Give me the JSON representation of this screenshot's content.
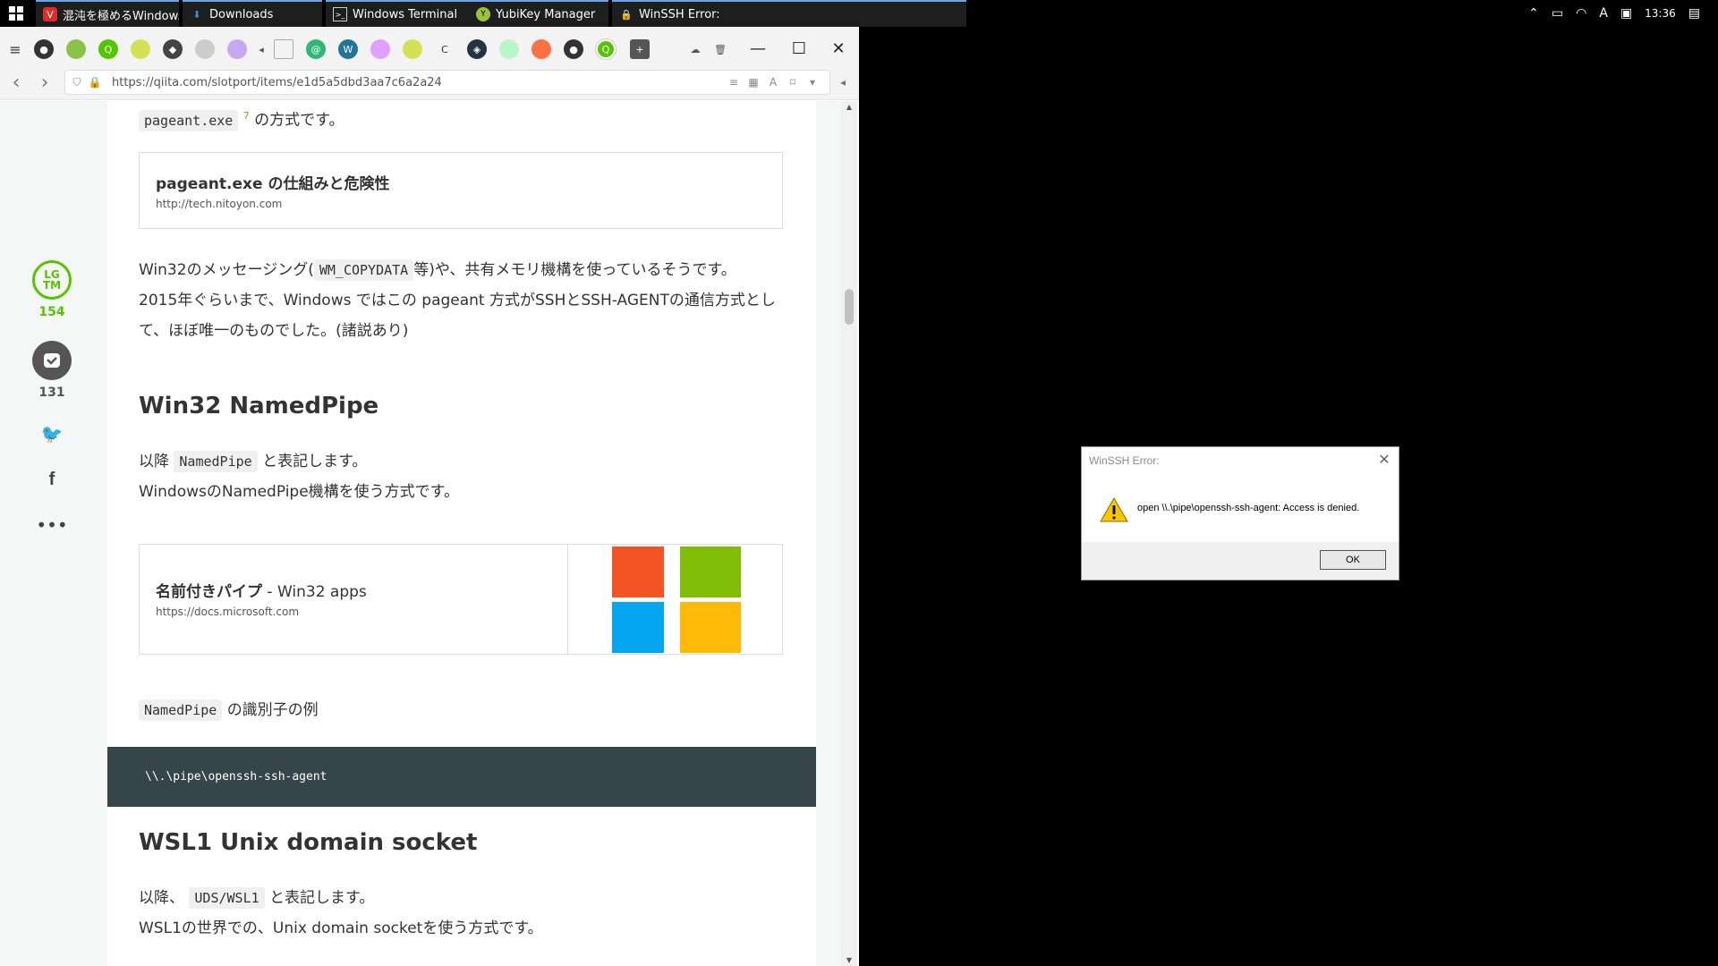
{
  "taskbar": {
    "tasks": [
      {
        "label": "混沌を極めるWindow...",
        "icon": "vivaldi-icon",
        "color": "#e02b2b"
      },
      {
        "label": "Downloads",
        "icon": "download-icon",
        "color": "#3a8fe8"
      },
      {
        "label": "Windows Terminal",
        "icon": "terminal-icon",
        "color": "#cccccc"
      },
      {
        "label": "YubiKey Manager",
        "icon": "yubikey-icon",
        "color": "#9ac33b"
      },
      {
        "label": "WinSSH Error:",
        "icon": "lock-icon",
        "color": "#f0c020"
      }
    ],
    "time": "13:36",
    "tray_letter": "A"
  },
  "browser": {
    "url": "https://qiita.com/slotport/items/e1d5a5dbd3aa7c6a2a24"
  },
  "sidebar": {
    "lgtm_label_top": "LG",
    "lgtm_label_bottom": "TM",
    "lgtm_count": "154",
    "stock_count": "131",
    "accent_color": "#55c500"
  },
  "article": {
    "p1_code": "pageant.exe",
    "p1_sup": "7",
    "p1_text": "の方式です。",
    "card1_title": "pageant.exe の仕組みと危険性",
    "card1_url": "http://tech.nitoyon.com",
    "p2_a": "Win32のメッセージング(",
    "p2_code": "WM_COPYDATA",
    "p2_b": "等)や、共有メモリ機構を使っているそうです。",
    "p3": "2015年ぐらいまで、Windows ではこの pageant 方式がSSHとSSH-AGENTの通信方式とし",
    "p4": "て、ほぼ唯一のものでした。(諸説あり)",
    "h2_namedpipe": "Win32 NamedPipe",
    "p5_a": "以降",
    "p5_code": "NamedPipe",
    "p5_b": "と表記します。",
    "p6": "WindowsのNamedPipe機構を使う方式です。",
    "card2_title_bold": "名前付きパイプ",
    "card2_title_rest": " - Win32 apps",
    "card2_url": "https://docs.microsoft.com",
    "p7_code": "NamedPipe",
    "p7_text": "の識別子の例",
    "code_block": "\\\\.\\pipe\\openssh-ssh-agent",
    "h2_wsl": "WSL1 Unix domain socket",
    "p8_a": "以降、",
    "p8_code": "UDS/WSL1",
    "p8_b": "と表記します。",
    "p9": "WSL1の世界での、Unix domain socketを使う方式です。"
  },
  "dialog": {
    "title": "WinSSH Error:",
    "message": "open \\\\.\\pipe\\openssh-ssh-agent: Access is denied.",
    "ok_label": "OK"
  }
}
